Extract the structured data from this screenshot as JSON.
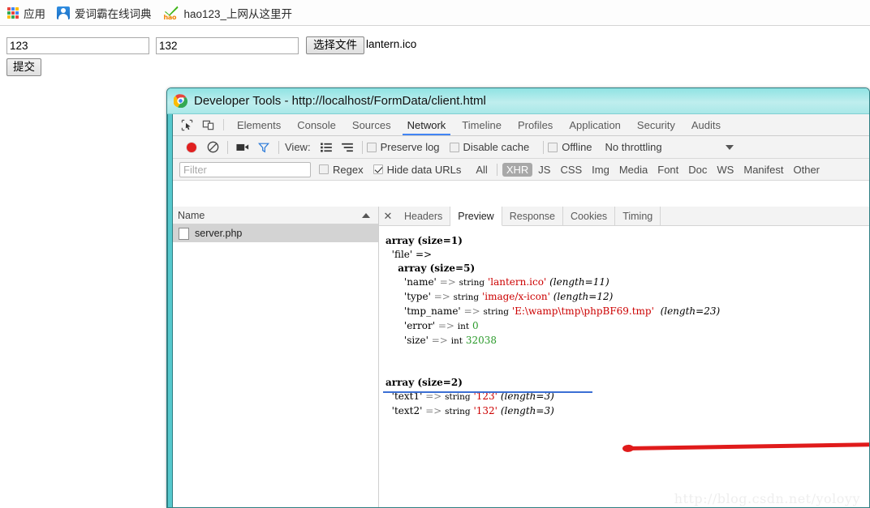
{
  "bookmarks": [
    {
      "icon": "apps-grid-icon",
      "label": "应用"
    },
    {
      "icon": "iciba-icon",
      "label": "爱词霸在线词典"
    },
    {
      "icon": "hao123-icon",
      "label": "hao123_上网从这里开"
    }
  ],
  "form": {
    "text1_value": "123",
    "text1_placeholder": "",
    "text2_value": "132",
    "text2_placeholder": "",
    "choose_file_label": "选择文件",
    "file_name": "lantern.ico",
    "submit_label": "提交"
  },
  "devtools": {
    "title": "Developer Tools - http://localhost/FormData/client.html",
    "tabs": [
      {
        "label": "Elements",
        "active": false
      },
      {
        "label": "Console",
        "active": false
      },
      {
        "label": "Sources",
        "active": false
      },
      {
        "label": "Network",
        "active": true
      },
      {
        "label": "Timeline",
        "active": false
      },
      {
        "label": "Profiles",
        "active": false
      },
      {
        "label": "Application",
        "active": false
      },
      {
        "label": "Security",
        "active": false
      },
      {
        "label": "Audits",
        "active": false
      }
    ],
    "toolbar": {
      "record_title": "record-button",
      "clear_title": "clear-button",
      "camera_title": "capture-screenshots",
      "funnel_title": "filter-toggle",
      "view_label": "View:",
      "preserve_log_label": "Preserve log",
      "preserve_log_checked": false,
      "disable_cache_label": "Disable cache",
      "disable_cache_checked": false,
      "offline_label": "Offline",
      "offline_checked": false,
      "throttling_value": "No throttling"
    },
    "filterbar": {
      "filter_placeholder": "Filter",
      "filter_value": "",
      "regex_label": "Regex",
      "regex_checked": false,
      "hide_data_urls_label": "Hide data URLs",
      "hide_data_urls_checked": true,
      "types": [
        {
          "label": "All",
          "active": false
        },
        {
          "label": "XHR",
          "active": true
        },
        {
          "label": "JS",
          "active": false
        },
        {
          "label": "CSS",
          "active": false
        },
        {
          "label": "Img",
          "active": false
        },
        {
          "label": "Media",
          "active": false
        },
        {
          "label": "Font",
          "active": false
        },
        {
          "label": "Doc",
          "active": false
        },
        {
          "label": "WS",
          "active": false
        },
        {
          "label": "Manifest",
          "active": false
        },
        {
          "label": "Other",
          "active": false
        }
      ]
    },
    "requests": {
      "column_header": "Name",
      "rows": [
        {
          "name": "server.php",
          "selected": true
        }
      ]
    },
    "detail_tabs": {
      "close_label": "✕",
      "tabs": [
        {
          "label": "Headers",
          "active": false
        },
        {
          "label": "Preview",
          "active": true
        },
        {
          "label": "Response",
          "active": false
        },
        {
          "label": "Cookies",
          "active": false
        },
        {
          "label": "Timing",
          "active": false
        }
      ]
    }
  },
  "dump": {
    "block1": {
      "l0": "array (size=1)",
      "l1": "'file' =>",
      "l2": "array (size=5)",
      "rows": [
        {
          "key": "'name'",
          "type": "string",
          "value": "'lantern.ico'",
          "value_kind": "string",
          "len": "(length=11)"
        },
        {
          "key": "'type'",
          "type": "string",
          "value": "'image/x-icon'",
          "value_kind": "string",
          "len": "(length=12)"
        },
        {
          "key": "'tmp_name'",
          "type": "string",
          "value": "'E:\\wamp\\tmp\\phpBF69.tmp'",
          "value_kind": "string",
          "len": "(length=23)"
        },
        {
          "key": "'error'",
          "type": "int",
          "value": "0",
          "value_kind": "int",
          "len": ""
        },
        {
          "key": "'size'",
          "type": "int",
          "value": "32038",
          "value_kind": "int",
          "len": ""
        }
      ]
    },
    "block2": {
      "l0": "array (size=2)",
      "rows": [
        {
          "key": "'text1'",
          "type": "string",
          "value": "'123'",
          "value_kind": "string",
          "len": "(length=3)"
        },
        {
          "key": "'text2'",
          "type": "string",
          "value": "'132'",
          "value_kind": "string",
          "len": "(length=3)"
        }
      ]
    }
  },
  "watermark": "http://blog.csdn.net/yoloyy",
  "colors": {
    "accent_blue": "#4285f4",
    "window_teal": "#56c8cd",
    "annotation_red": "#e01b1b",
    "annotation_blue": "#3b6fd4",
    "string_value": "#cc0000",
    "int_value": "#2a9a2a",
    "record_red": "#e02020"
  }
}
